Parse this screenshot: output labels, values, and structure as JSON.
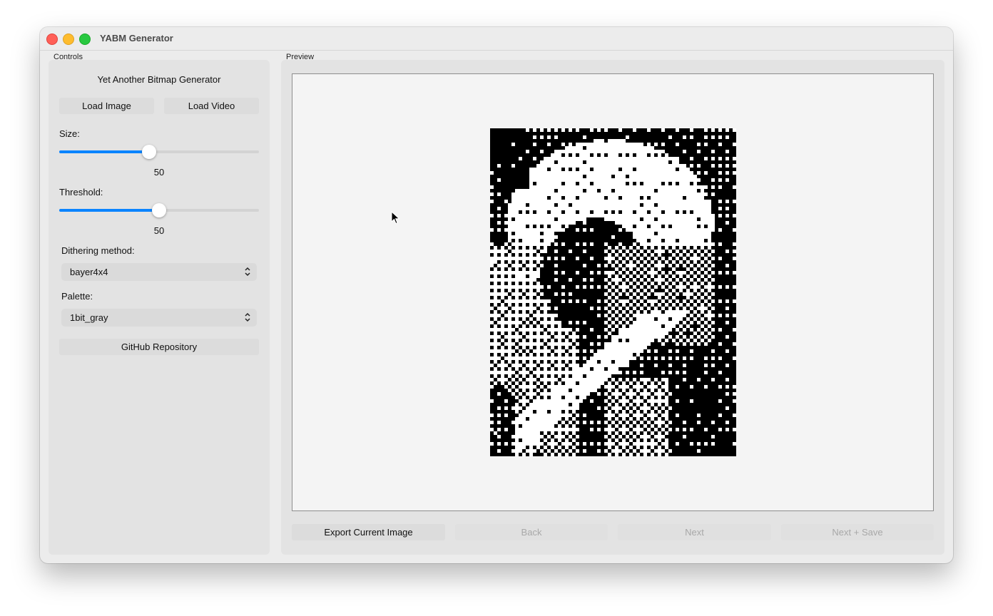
{
  "window": {
    "title": "YABM Generator"
  },
  "controls": {
    "group_label": "Controls",
    "heading": "Yet Another Bitmap Generator",
    "load_image": "Load Image",
    "load_video": "Load Video",
    "size_label": "Size:",
    "size_value": "50",
    "size_level": 0.45,
    "threshold_label": "Threshold:",
    "threshold_value": "50",
    "threshold_level": 0.5,
    "dithering_label": "Dithering method:",
    "dithering_value": "bayer4x4",
    "palette_label": "Palette:",
    "palette_value": "1bit_gray",
    "github": "GitHub Repository"
  },
  "preview": {
    "group_label": "Preview",
    "export": "Export Current Image",
    "back": "Back",
    "next": "Next",
    "next_save": "Next + Save"
  },
  "colors": {
    "accent": "#0a84ff",
    "bitmap_dark": "#000000",
    "bitmap_light": "#ffffff"
  }
}
